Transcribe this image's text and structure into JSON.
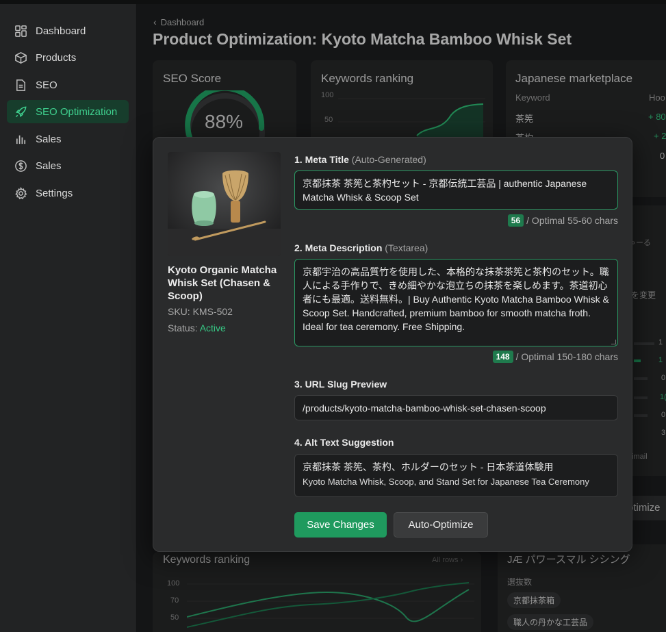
{
  "sidebar": {
    "items": [
      {
        "label": "Dashboard",
        "icon": "dashboard-icon"
      },
      {
        "label": "Products",
        "icon": "box-icon"
      },
      {
        "label": "SEO",
        "icon": "document-icon"
      },
      {
        "label": "SEO Optimization",
        "icon": "rocket-icon",
        "active": true
      },
      {
        "label": "Sales",
        "icon": "bar-chart-icon"
      },
      {
        "label": "Sales",
        "icon": "dollar-icon"
      },
      {
        "label": "Settings",
        "icon": "gear-icon"
      }
    ]
  },
  "header": {
    "breadcrumb": "Dashboard",
    "title": "Product Optimization: Kyoto Matcha Bamboo Whisk Set"
  },
  "background": {
    "seo_score": {
      "title": "SEO Score",
      "value": "88%"
    },
    "keywords_card": {
      "title": "Keywords ranking",
      "ticks": [
        "100",
        "50"
      ]
    },
    "jp_market": {
      "title": "Japanese marketplace",
      "col_keyword": "Keyword",
      "col_hood": "Hoo",
      "rows": [
        {
          "keyword": "茶筅",
          "value": "+ 80"
        },
        {
          "keyword": "茶杓",
          "value": "+ 2"
        },
        {
          "keyword": "",
          "value": "0"
        }
      ]
    },
    "right_fragments": {
      "f1": "ゃーる",
      "f2": "を変更",
      "f3": "timail",
      "f4": "otimize",
      "numbers": [
        "1",
        "1",
        "0",
        "1(",
        "0",
        "3"
      ]
    },
    "keywords_bottom": {
      "title": "Keywords ranking",
      "link": "All rows",
      "ticks": [
        "100",
        "70",
        "50"
      ]
    },
    "jp_power": {
      "title": "JÆ パワースマル シシング",
      "subtitle": "選抜数",
      "chips": [
        "京都抹茶箱",
        "職人の丹かな工芸品"
      ]
    }
  },
  "modal": {
    "product": {
      "name": "Kyoto Organic Matcha Whisk Set (Chasen & Scoop)",
      "sku": "SKU: KMS-502",
      "status_label": "Status: ",
      "status_value": "Active"
    },
    "meta_title": {
      "label": "1. Meta Title",
      "sub": "(Auto-Generated)",
      "value": "京都抹茶 茶筅と茶杓セット - 京都伝統工芸品 | authentic Japanese Matcha Whisk & Scoop Set",
      "count": "56",
      "hint": "/ Optimal 55-60 chars"
    },
    "meta_description": {
      "label": "2. Meta Description",
      "sub": "(Textarea)",
      "value": "京都宇治の高品質竹を使用した、本格的な抹茶茶筅と茶杓のセット。職人による手作りで、きめ細やかな泡立ちの抹茶を楽しめます。茶道初心者にも最適。送料無料。| Buy Authentic Kyoto Matcha Bamboo Whisk & Scoop Set. Handcrafted, premium bamboo for smooth matcha froth. Ideal for tea ceremony. Free Shipping.",
      "count": "148",
      "hint": "/ Optimal 150-180 chars"
    },
    "url_slug": {
      "label": "3. URL Slug Preview",
      "value": "/products/kyoto-matcha-bamboo-whisk-set-chasen-scoop"
    },
    "alt_text": {
      "label": "4. Alt Text Suggestion",
      "jp": "京都抹茶 茶筅、茶杓、ホルダーのセット - 日本茶道体験用",
      "en": "Kyoto Matcha Whisk, Scoop, and Stand Set for Japanese Tea Ceremony"
    },
    "buttons": {
      "save": "Save Changes",
      "optimize": "Auto-Optimize"
    }
  },
  "colors": {
    "accent": "#1f9a5e",
    "active_text": "#3fcf8e",
    "background": "#1d1e1f"
  }
}
